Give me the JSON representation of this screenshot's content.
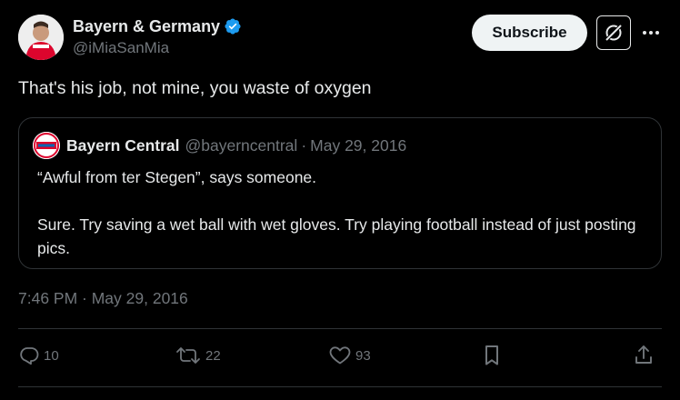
{
  "author": {
    "display_name": "Bayern & Germany",
    "handle": "@iMiaSanMia",
    "verified": true
  },
  "header": {
    "subscribe_label": "Subscribe",
    "grok_icon": "grok-icon",
    "more_icon": "more-dots-icon"
  },
  "tweet": {
    "text": "That's his job, not mine, you waste of oxygen",
    "timestamp": "7:46 PM · May 29, 2016"
  },
  "quoted_tweet": {
    "display_name": "Bayern Central",
    "handle": "@bayerncentral",
    "separator": "·",
    "date": "May 29, 2016",
    "line1": "“Awful from ter Stegen”, says someone.",
    "line2": "Sure. Try saving a wet ball with wet gloves. Try playing football instead of just posting pics."
  },
  "actions": {
    "replies": "10",
    "retweets": "22",
    "likes": "93"
  },
  "colors": {
    "background": "#000000",
    "text": "#e7e9ea",
    "muted": "#71767b",
    "border": "#2f3336",
    "verified": "#1d9bf0"
  }
}
